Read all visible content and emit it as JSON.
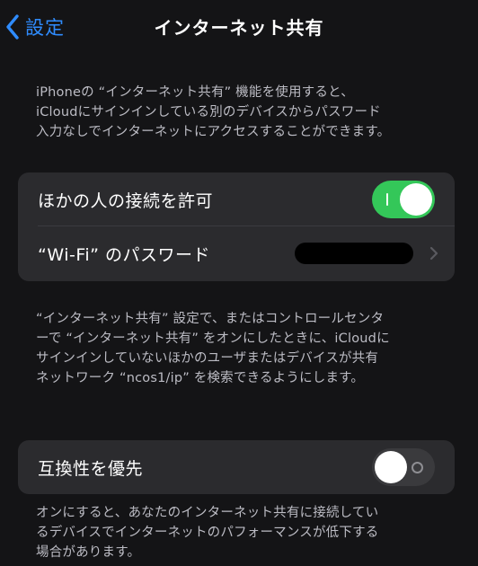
{
  "nav": {
    "back_label": "設定",
    "title": "インターネット共有"
  },
  "intro": {
    "lines": [
      "iPhoneの “インターネット共有” 機能を使用すると、",
      "iCloudにサインインしている別のデバイスからパスワード",
      "入力なしでインターネットにアクセスすることができます。"
    ]
  },
  "sharing_group": {
    "allow_others": {
      "label": "ほかの人の接続を許可",
      "enabled": true
    },
    "wifi_password": {
      "label": "“Wi-Fi” のパスワード",
      "value_redacted": true
    }
  },
  "discovery_note": {
    "lines": [
      "“インターネット共有” 設定で、またはコントロールセンタ",
      "ーで “インターネット共有” をオンにしたときに、iCloudに",
      "サインインしていないほかのユーザまたはデバイスが共有",
      "ネットワーク “ncos1/ip” を検索できるようにします。"
    ]
  },
  "compat_group": {
    "maximize_compatibility": {
      "label": "互換性を優先",
      "enabled": false
    }
  },
  "compat_note": {
    "lines": [
      "オンにすると、あなたのインターネット共有に接続してい",
      "るデバイスでインターネットのパフォーマンスが低下する",
      "場合があります。"
    ]
  },
  "colors": {
    "accent_blue": "#2f8cff",
    "toggle_on": "#34c759",
    "toggle_off": "#3a3a3d",
    "cell_background": "#2b2b2e",
    "background": "#141416",
    "secondary_text": "#bcbcc4"
  },
  "icons": {
    "back": "chevron-left-icon",
    "disclosure": "chevron-right-icon"
  }
}
